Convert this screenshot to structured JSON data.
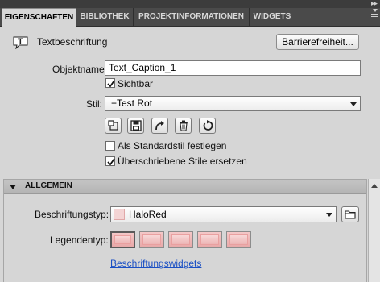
{
  "tabs": [
    {
      "label": "EIGENSCHAFTEN",
      "active": true
    },
    {
      "label": "BIBLIOTHEK",
      "active": false
    },
    {
      "label": "PROJEKTINFORMATIONEN",
      "active": false
    },
    {
      "label": "WIDGETS",
      "active": false
    }
  ],
  "header": {
    "object_type": "Textbeschriftung",
    "object_icon": "text-caption-icon",
    "accessibility_button": "Barrierefreiheit..."
  },
  "properties": {
    "object_name_label": "Objektname:",
    "object_name_value": "Text_Caption_1",
    "visible_label": "Sichtbar",
    "visible_checked": true,
    "style_label": "Stil:",
    "style_value": "+Test Rot",
    "style_actions": [
      "reset-style-icon",
      "save-icon",
      "share-arrow-icon",
      "trash-icon",
      "refresh-icon"
    ],
    "default_style_label": "Als Standardstil festlegen",
    "default_style_checked": false,
    "override_styles_label": "Überschriebene Stile ersetzen",
    "override_styles_checked": true
  },
  "general": {
    "title": "ALLGEMEIN",
    "caption_type_label": "Beschriftungstyp:",
    "caption_type_value": "HaloRed",
    "legend_type_label": "Legendentyp:",
    "legend_count": 5,
    "widgets_link": "Beschriftungswidgets"
  },
  "colors": {
    "tab_bar": "#4a4a4a",
    "panel_bg": "#d6d6d6",
    "link": "#1a4fc4",
    "swatch": "#f0c0c0"
  }
}
